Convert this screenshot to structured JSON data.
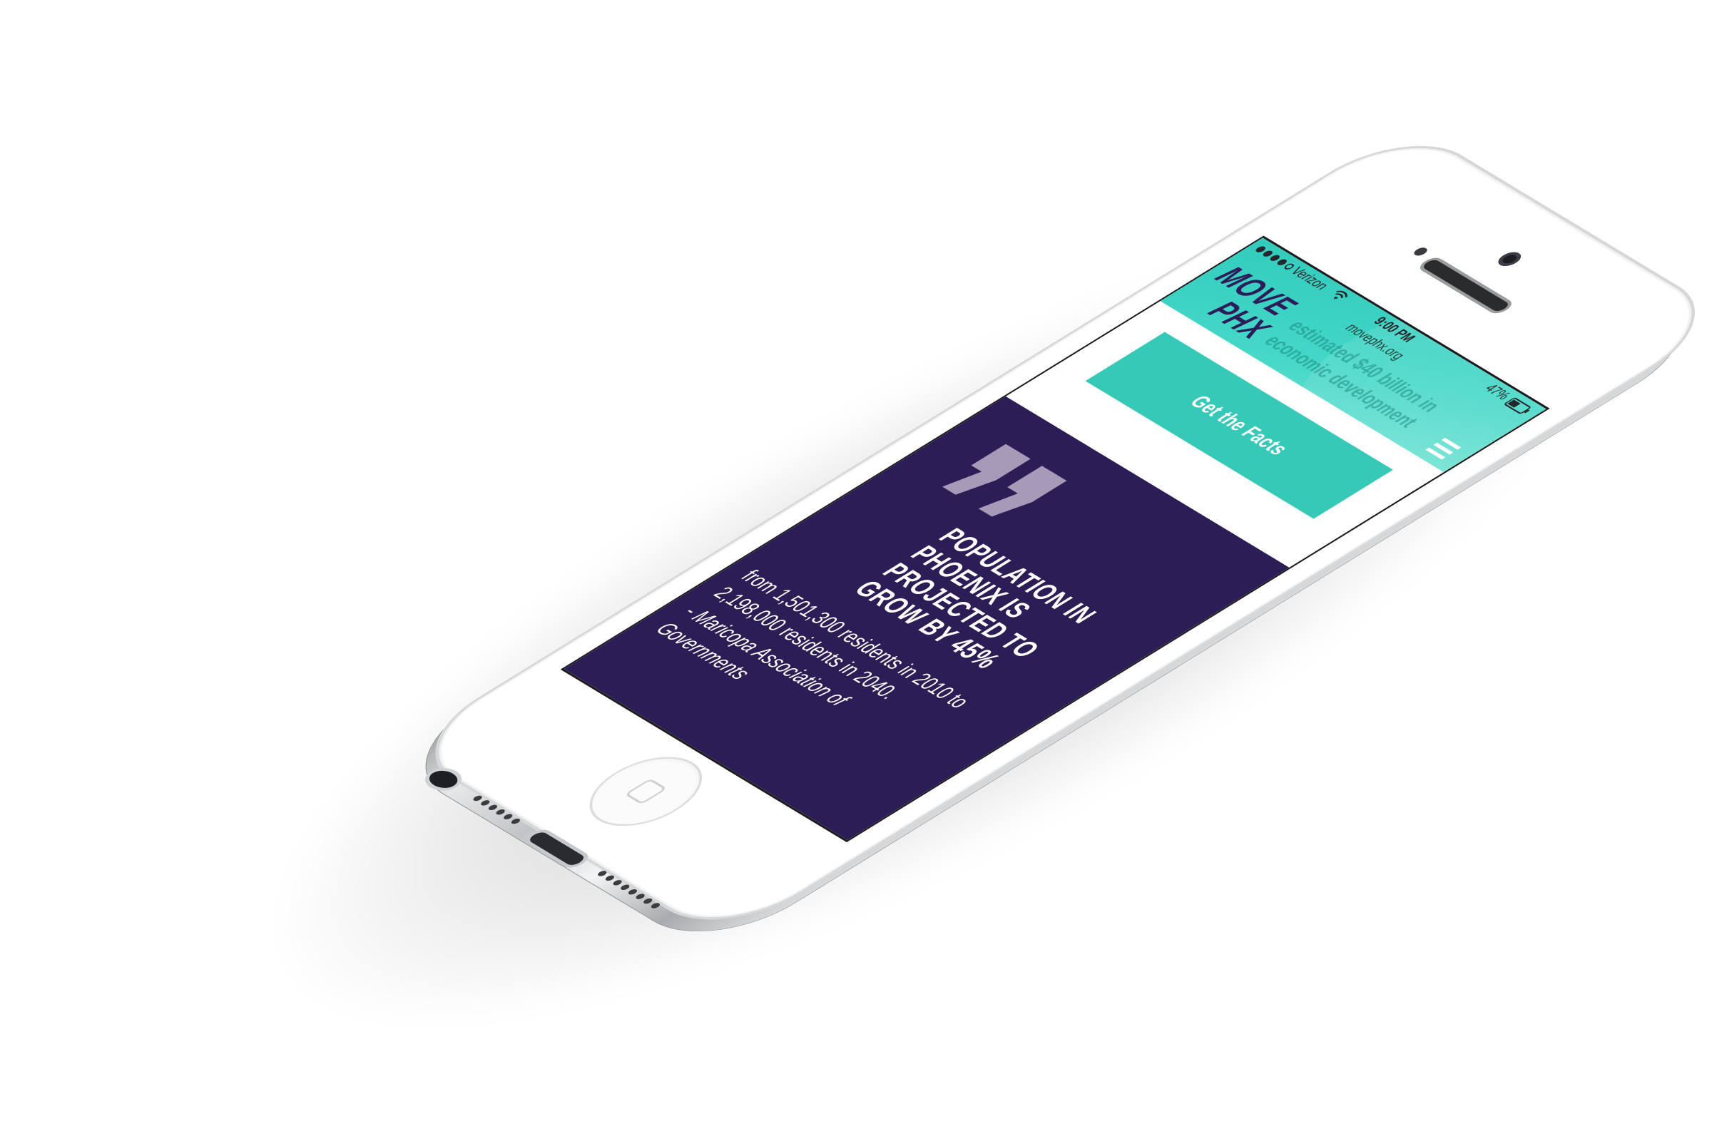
{
  "status_bar": {
    "carrier": "Verizon",
    "time": "9:00 PM",
    "battery": "47%"
  },
  "browser": {
    "url": "movephx.org"
  },
  "header": {
    "logo_line1": "MOVE",
    "logo_line2": "PHX",
    "stat_text": "estimated $40 billion in economic development"
  },
  "cta": {
    "label": "Get the Facts"
  },
  "quote": {
    "headline": "Population in Phoenix is projected to grow by 45%",
    "body": "from 1,501,300 residents in 2010 to 2,198,000 residents in 2040.",
    "attribution": "- Maricopa Association of Governments"
  },
  "colors": {
    "teal": "#37c9b8",
    "purple": "#2c1d57",
    "logo": "#2c1d5a",
    "quote_mark": "#a79ab8"
  },
  "icons": {
    "menu": "hamburger-icon",
    "quote": "quote-mark-icon",
    "wifi": "wifi-icon",
    "battery": "battery-icon"
  }
}
